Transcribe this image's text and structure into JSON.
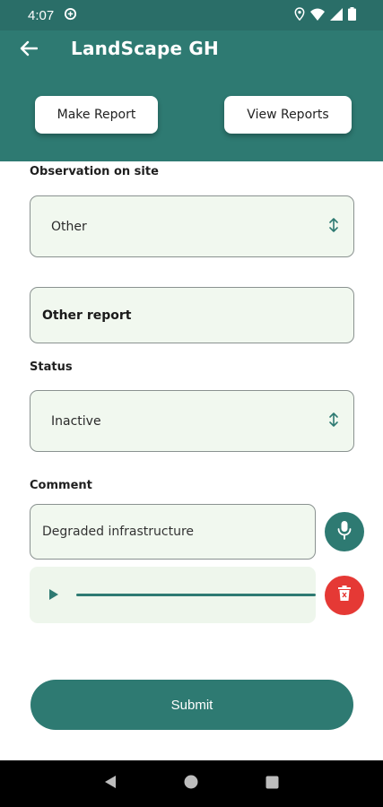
{
  "status_bar": {
    "time": "4:07",
    "icons": [
      "data-saver-icon",
      "location-icon",
      "wifi-icon",
      "signal-icon",
      "battery-icon"
    ]
  },
  "header": {
    "title": "LandScape GH",
    "back_icon": "arrow-left-icon",
    "make_report_label": "Make Report",
    "view_reports_label": "View Reports"
  },
  "form": {
    "observation": {
      "label": "Observation on site",
      "value": "Other",
      "icon": "up-down-arrows-icon"
    },
    "other_report": {
      "value": "Other report"
    },
    "status": {
      "label": "Status",
      "value": "Inactive",
      "icon": "up-down-arrows-icon"
    },
    "comment": {
      "label": "Comment",
      "value": "Degraded infrastructure",
      "mic_icon": "microphone-icon"
    },
    "audio": {
      "play_icon": "play-icon",
      "delete_icon": "trash-icon",
      "progress": 0
    },
    "submit_label": "Submit"
  },
  "nav_bar": {
    "icons": [
      "back-triangle-icon",
      "home-circle-icon",
      "recents-square-icon"
    ]
  },
  "colors": {
    "primary": "#2e7a72",
    "status_bar": "#2a6e68",
    "field_bg": "#f1f8ef",
    "delete": "#e53935"
  }
}
